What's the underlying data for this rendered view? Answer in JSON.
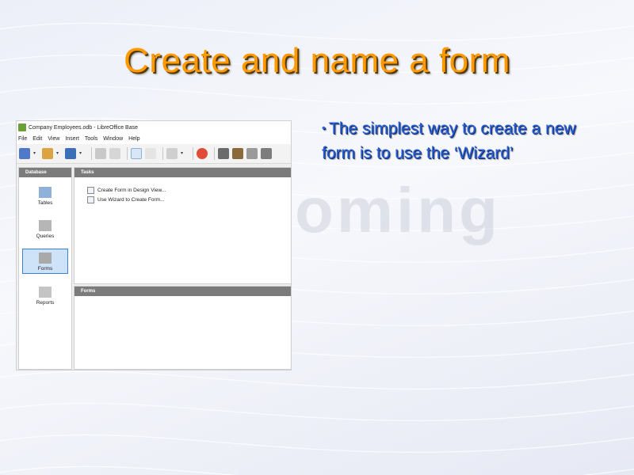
{
  "slide": {
    "title": "Create and name a form",
    "bullet": "The simplest way to create a new form is to use the ‘Wizard’",
    "watermark": "oming"
  },
  "window": {
    "title": "Company Employees.odb - LibreOffice Base",
    "menu": [
      "File",
      "Edit",
      "View",
      "Insert",
      "Tools",
      "Window",
      "Help"
    ]
  },
  "database_panel": {
    "header": "Database",
    "items": [
      {
        "label": "Tables",
        "icon": "table-icon"
      },
      {
        "label": "Queries",
        "icon": "query-icon"
      },
      {
        "label": "Forms",
        "icon": "form-icon",
        "selected": true
      },
      {
        "label": "Reports",
        "icon": "report-icon"
      }
    ]
  },
  "tasks_panel": {
    "header": "Tasks",
    "items": [
      "Create Form in Design View...",
      "Use Wizard to Create Form..."
    ]
  },
  "forms_panel": {
    "header": "Forms"
  },
  "colors": {
    "title": "#ff9900",
    "bullet": "#2a5fd6",
    "selection": "#cfe3f8"
  }
}
